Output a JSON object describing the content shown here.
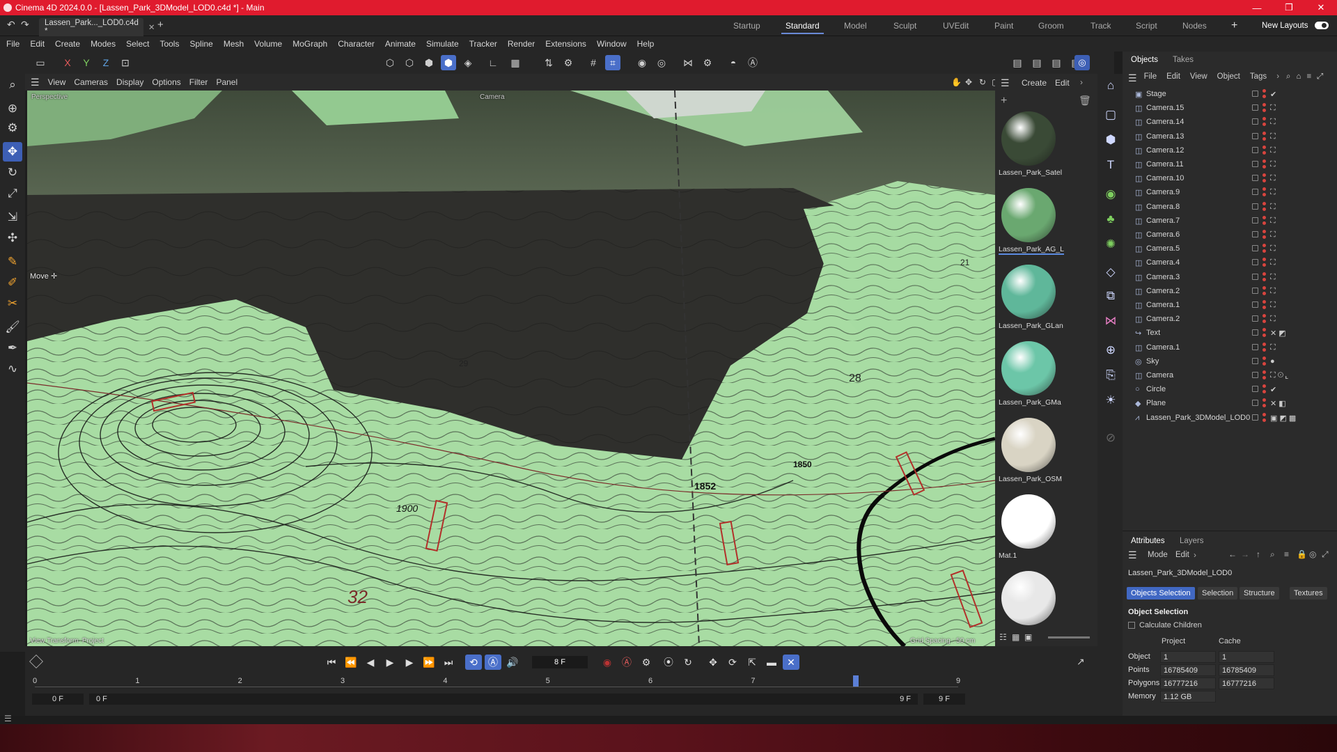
{
  "window": {
    "title": "Cinema 4D 2024.0.0 - [Lassen_Park_3DModel_LOD0.c4d *] - Main",
    "controls": [
      "—",
      "❐",
      "✕"
    ]
  },
  "document_tab": {
    "label": "Lassen_Park..._LOD0.c4d *"
  },
  "layouts": {
    "items": [
      "Startup",
      "Standard",
      "Model",
      "Sculpt",
      "UVEdit",
      "Paint",
      "Groom",
      "Track",
      "Script",
      "Nodes"
    ],
    "active": "Standard",
    "new_layouts": "New Layouts"
  },
  "menu": [
    "File",
    "Edit",
    "Create",
    "Modes",
    "Select",
    "Tools",
    "Spline",
    "Mesh",
    "Volume",
    "MoGraph",
    "Character",
    "Animate",
    "Simulate",
    "Tracker",
    "Render",
    "Extensions",
    "Window",
    "Help"
  ],
  "toolbar": {
    "x": "X",
    "y": "Y",
    "z": "Z"
  },
  "viewport": {
    "menu": [
      "View",
      "Cameras",
      "Display",
      "Options",
      "Filter",
      "Panel"
    ],
    "camera_label": "Perspective",
    "camera2_label": "Camera",
    "tool_label": "Move ✛",
    "view_transform": "View Transform: Project",
    "grid_spacing": "Grid Spacing : 50 cm",
    "map_labels": [
      "1900",
      "1852",
      "1850",
      "32",
      "29",
      "28",
      "21"
    ]
  },
  "materials": {
    "menu": [
      "Create",
      "Edit"
    ],
    "items": [
      {
        "name": "Lassen_Park_Satel",
        "color": "#3a4a36"
      },
      {
        "name": "Lassen_Park_AG_L",
        "color": "#6aa870"
      },
      {
        "name": "Lassen_Park_GLan",
        "color": "#5fb79a"
      },
      {
        "name": "Lassen_Park_GMa",
        "color": "#6cc6a8"
      },
      {
        "name": "Lassen_Park_OSM",
        "color": "#d9d4c4"
      },
      {
        "name": "Mat.1",
        "color": "#ffffff"
      },
      {
        "name": "",
        "color": "#e8e8e8"
      }
    ]
  },
  "objects_panel": {
    "tabs": [
      "Objects",
      "Takes"
    ],
    "menu": [
      "File",
      "Edit",
      "View",
      "Object",
      "Tags"
    ],
    "rows": [
      {
        "name": "Stage",
        "icon": "▣",
        "tag": "✔"
      },
      {
        "name": "Camera.15",
        "icon": "◫",
        "tag": "⛶"
      },
      {
        "name": "Camera.14",
        "icon": "◫",
        "tag": "⛶"
      },
      {
        "name": "Camera.13",
        "icon": "◫",
        "tag": "⛶"
      },
      {
        "name": "Camera.12",
        "icon": "◫",
        "tag": "⛶"
      },
      {
        "name": "Camera.11",
        "icon": "◫",
        "tag": "⛶"
      },
      {
        "name": "Camera.10",
        "icon": "◫",
        "tag": "⛶"
      },
      {
        "name": "Camera.9",
        "icon": "◫",
        "tag": "⛶"
      },
      {
        "name": "Camera.8",
        "icon": "◫",
        "tag": "⛶"
      },
      {
        "name": "Camera.7",
        "icon": "◫",
        "tag": "⛶"
      },
      {
        "name": "Camera.6",
        "icon": "◫",
        "tag": "⛶"
      },
      {
        "name": "Camera.5",
        "icon": "◫",
        "tag": "⛶"
      },
      {
        "name": "Camera.4",
        "icon": "◫",
        "tag": "⛶"
      },
      {
        "name": "Camera.3",
        "icon": "◫",
        "tag": "⛶"
      },
      {
        "name": "Camera.2",
        "icon": "◫",
        "tag": "⛶"
      },
      {
        "name": "Camera.1",
        "icon": "◫",
        "tag": "⛶"
      },
      {
        "name": "Camera.2",
        "icon": "◫",
        "tag": "⛶"
      },
      {
        "name": "Text",
        "icon": "↪",
        "tag": "✕ ◩"
      },
      {
        "name": "Camera.1",
        "icon": "◫",
        "tag": "⛶"
      },
      {
        "name": "Sky",
        "icon": "◎",
        "tag": "●"
      },
      {
        "name": "Camera",
        "icon": "◫",
        "tag": "⛶ ⊙ ⌞"
      },
      {
        "name": "Circle",
        "icon": "○",
        "tag": "✔"
      },
      {
        "name": "Plane",
        "icon": "◆",
        "tag": "✕ ◧"
      },
      {
        "name": "Lassen_Park_3DModel_LOD0",
        "icon": "⩘",
        "tag": "▣ ◩ ▩"
      }
    ]
  },
  "attributes_panel": {
    "tabs": [
      "Attributes",
      "Layers"
    ],
    "menu": [
      "Mode",
      "Edit"
    ],
    "object_name": "Lassen_Park_3DModel_LOD0",
    "buttons": [
      "Objects Selection",
      "Selection",
      "Structure",
      "Textures"
    ],
    "section": "Object Selection",
    "calculate_children": "Calculate Children",
    "col_project": "Project",
    "col_cache": "Cache",
    "rows": [
      {
        "label": "Object",
        "project": "1",
        "cache": "1"
      },
      {
        "label": "Points",
        "project": "16785409",
        "cache": "16785409"
      },
      {
        "label": "Polygons",
        "project": "16777216",
        "cache": "16777216"
      },
      {
        "label": "Memory",
        "project": "1.12 GB",
        "cache": ""
      }
    ]
  },
  "timeline": {
    "current_frame": "8 F",
    "ruler": [
      "0",
      "1",
      "2",
      "3",
      "4",
      "5",
      "6",
      "7",
      "8",
      "9"
    ],
    "start_frame": "0 F",
    "min_frame": "0 F",
    "max_frame": "9 F",
    "end_frame": "9 F",
    "playhead": 8
  },
  "colors": {
    "accent": "#4a6fc9",
    "titlebar": "#e01b2e",
    "map_green": "#9fd69a",
    "satellite_dark": "#2f2f2c"
  }
}
